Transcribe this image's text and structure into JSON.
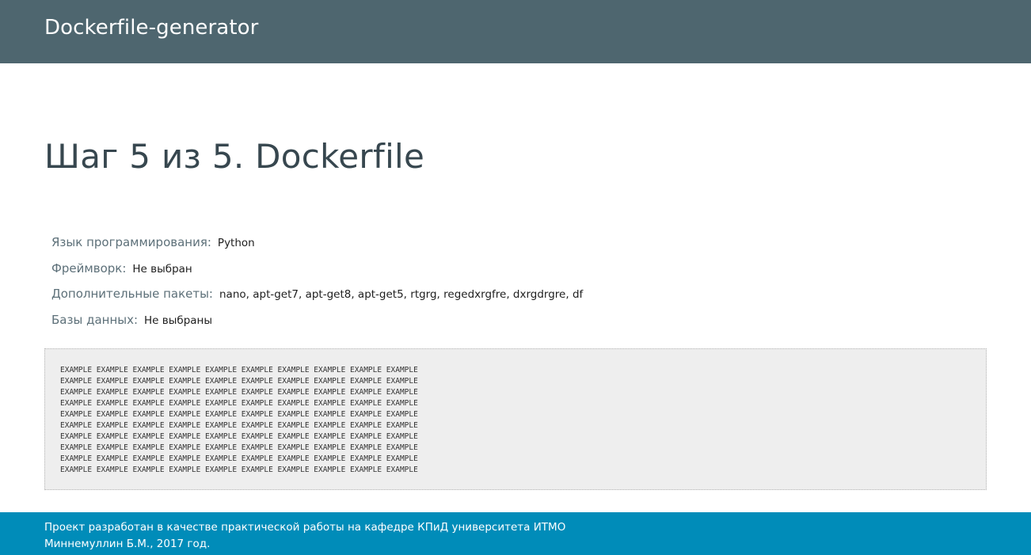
{
  "header": {
    "brand": "Dockerfile-generator"
  },
  "main": {
    "title": "Шаг 5 из 5. Dockerfile",
    "summary": [
      {
        "label": "Язык программирования:",
        "value": "Python"
      },
      {
        "label": "Фреймворк:",
        "value": "Не выбран"
      },
      {
        "label": "Дополнительные пакеты:",
        "value": "nano, apt-get7, apt-get8, apt-get5, rtgrg, regedxrgfre, dxrgdrgre, df"
      },
      {
        "label": "Базы данных:",
        "value": "Не выбраны"
      }
    ],
    "dockerfile_lines": [
      "EXAMPLE EXAMPLE EXAMPLE EXAMPLE EXAMPLE EXAMPLE EXAMPLE EXAMPLE EXAMPLE EXAMPLE",
      "EXAMPLE EXAMPLE EXAMPLE EXAMPLE EXAMPLE EXAMPLE EXAMPLE EXAMPLE EXAMPLE EXAMPLE",
      "EXAMPLE EXAMPLE EXAMPLE EXAMPLE EXAMPLE EXAMPLE EXAMPLE EXAMPLE EXAMPLE EXAMPLE",
      "EXAMPLE EXAMPLE EXAMPLE EXAMPLE EXAMPLE EXAMPLE EXAMPLE EXAMPLE EXAMPLE EXAMPLE",
      "EXAMPLE EXAMPLE EXAMPLE EXAMPLE EXAMPLE EXAMPLE EXAMPLE EXAMPLE EXAMPLE EXAMPLE",
      "EXAMPLE EXAMPLE EXAMPLE EXAMPLE EXAMPLE EXAMPLE EXAMPLE EXAMPLE EXAMPLE EXAMPLE",
      "EXAMPLE EXAMPLE EXAMPLE EXAMPLE EXAMPLE EXAMPLE EXAMPLE EXAMPLE EXAMPLE EXAMPLE",
      "EXAMPLE EXAMPLE EXAMPLE EXAMPLE EXAMPLE EXAMPLE EXAMPLE EXAMPLE EXAMPLE EXAMPLE",
      "EXAMPLE EXAMPLE EXAMPLE EXAMPLE EXAMPLE EXAMPLE EXAMPLE EXAMPLE EXAMPLE EXAMPLE",
      "EXAMPLE EXAMPLE EXAMPLE EXAMPLE EXAMPLE EXAMPLE EXAMPLE EXAMPLE EXAMPLE EXAMPLE"
    ]
  },
  "footer": {
    "line1": "Проект разработан в качестве практической работы на кафедре КПиД университета ИТМО",
    "line2": "Миннемуллин Б.М., 2017 год."
  },
  "colors": {
    "header_bg": "#4e666f",
    "footer_bg": "#008cb9",
    "title_text": "#37474f",
    "code_bg": "#eeeeee"
  }
}
